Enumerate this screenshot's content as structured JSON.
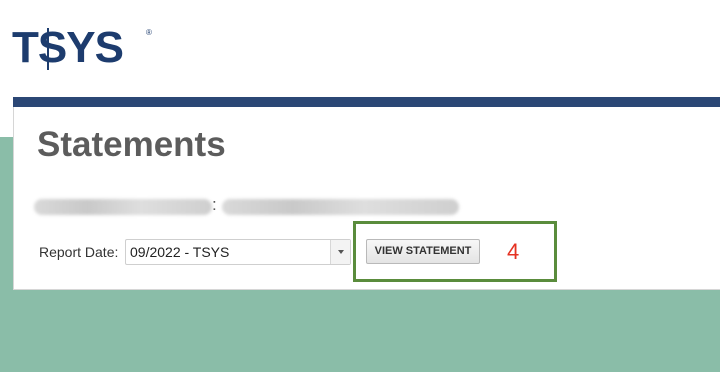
{
  "brand": {
    "logo_text": "TSYS",
    "registered_mark": "®",
    "color": "#1d3c6e"
  },
  "page": {
    "title": "Statements",
    "separator": ":"
  },
  "report": {
    "label": "Report Date:",
    "selected_value": "09/2022 - TSYS",
    "view_button_label": "VIEW STATEMENT"
  },
  "annotation": {
    "step_number": "4",
    "highlight_color": "#5a8c3c",
    "number_color": "#e53222"
  },
  "colors": {
    "header_bar": "#2b4775",
    "background": "#8abda8"
  }
}
